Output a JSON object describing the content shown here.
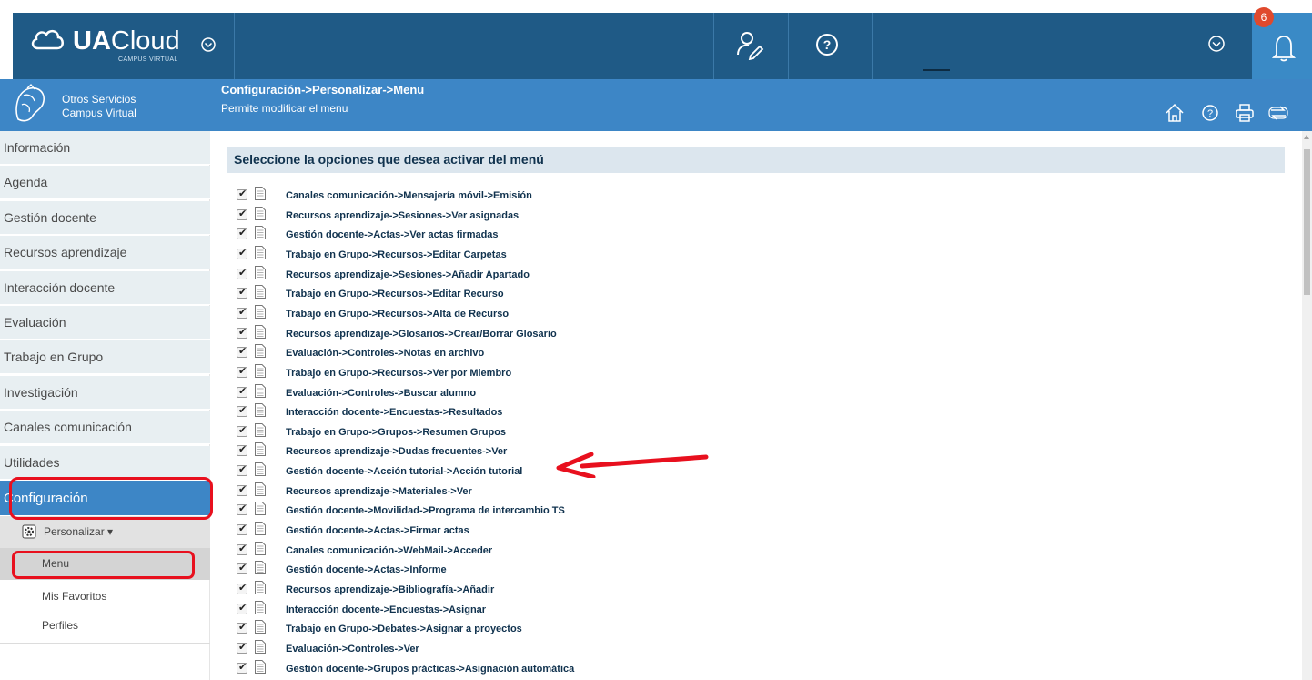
{
  "topbar": {
    "logo_bold": "UA",
    "logo_rest": "Cloud",
    "logo_sub": "CAMPUS VIRTUAL",
    "notification_count": "6"
  },
  "header": {
    "service_line1": "Otros Servicios",
    "service_line2": "Campus Virtual",
    "breadcrumb": "Configuración->Personalizar->Menu",
    "subtitle": "Permite modificar el menu"
  },
  "sidebar": {
    "items": [
      {
        "label": "Información"
      },
      {
        "label": "Agenda"
      },
      {
        "label": "Gestión docente"
      },
      {
        "label": "Recursos aprendizaje"
      },
      {
        "label": "Interacción docente"
      },
      {
        "label": "Evaluación"
      },
      {
        "label": "Trabajo en Grupo"
      },
      {
        "label": "Investigación"
      },
      {
        "label": "Canales comunicación"
      },
      {
        "label": "Utilidades"
      },
      {
        "label": "Configuración"
      }
    ],
    "submenu_label": "Personalizar ▾",
    "sub_items": [
      {
        "label": "Menu"
      },
      {
        "label": "Mis Favoritos"
      },
      {
        "label": "Perfiles"
      }
    ]
  },
  "main": {
    "heading": "Seleccione la opciones que desea activar del menú",
    "options": [
      {
        "label": "Canales comunicación->Mensajería móvil->Emisión",
        "checked": true
      },
      {
        "label": "Recursos aprendizaje->Sesiones->Ver asignadas",
        "checked": true
      },
      {
        "label": "Gestión docente->Actas->Ver actas firmadas",
        "checked": true
      },
      {
        "label": "Trabajo en Grupo->Recursos->Editar Carpetas",
        "checked": true
      },
      {
        "label": "Recursos aprendizaje->Sesiones->Añadir Apartado",
        "checked": true
      },
      {
        "label": "Trabajo en Grupo->Recursos->Editar Recurso",
        "checked": true
      },
      {
        "label": "Trabajo en Grupo->Recursos->Alta de Recurso",
        "checked": true
      },
      {
        "label": "Recursos aprendizaje->Glosarios->Crear/Borrar Glosario",
        "checked": true
      },
      {
        "label": "Evaluación->Controles->Notas en archivo",
        "checked": true
      },
      {
        "label": "Trabajo en Grupo->Recursos->Ver por Miembro",
        "checked": true
      },
      {
        "label": "Evaluación->Controles->Buscar alumno",
        "checked": true
      },
      {
        "label": "Interacción docente->Encuestas->Resultados",
        "checked": true
      },
      {
        "label": "Trabajo en Grupo->Grupos->Resumen Grupos",
        "checked": true
      },
      {
        "label": "Recursos aprendizaje->Dudas frecuentes->Ver",
        "checked": true
      },
      {
        "label": "Gestión docente->Acción tutorial->Acción tutorial",
        "checked": true
      },
      {
        "label": "Recursos aprendizaje->Materiales->Ver",
        "checked": true
      },
      {
        "label": "Gestión docente->Movilidad->Programa de intercambio TS",
        "checked": true
      },
      {
        "label": "Gestión docente->Actas->Firmar actas",
        "checked": true
      },
      {
        "label": "Canales comunicación->WebMail->Acceder",
        "checked": true
      },
      {
        "label": "Gestión docente->Actas->Informe",
        "checked": true
      },
      {
        "label": "Recursos aprendizaje->Bibliografía->Añadir",
        "checked": true
      },
      {
        "label": "Interacción docente->Encuestas->Asignar",
        "checked": true
      },
      {
        "label": "Trabajo en Grupo->Debates->Asignar a proyectos",
        "checked": true
      },
      {
        "label": "Evaluación->Controles->Ver",
        "checked": true
      },
      {
        "label": "Gestión docente->Grupos prácticas->Asignación automática",
        "checked": true
      }
    ]
  },
  "colors": {
    "topnav": "#1f5a86",
    "header_band": "#3d86c6",
    "annotation_red": "#e8101e"
  }
}
